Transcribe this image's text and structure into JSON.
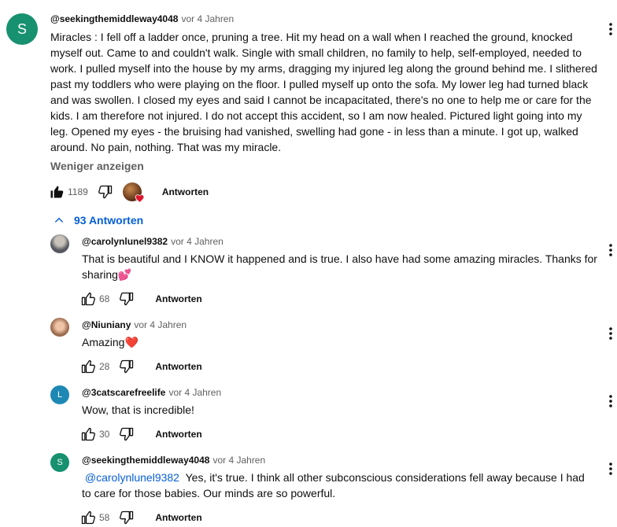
{
  "main_comment": {
    "avatar_letter": "S",
    "avatar_color": "#17916f",
    "author": "@seekingthemiddleway4048",
    "time": "vor 4 Jahren",
    "text_lines": [
      "Miracles : I fell off a ladder once, pruning a tree. Hit my head on a wall when I reached the ground, knocked",
      "myself out. Came to and couldn't walk. Single with small children, no family to help, self-employed, needed to",
      "work. I pulled myself into the house by my arms, dragging my injured leg along the ground behind me. I slithered",
      "past my toddlers who were playing on the floor. I pulled myself up onto the sofa. My lower leg had turned black",
      "and was swollen. I closed my eyes and said I cannot be incapacitated, there's no one to help me or care for the",
      "kids. I am therefore not injured. I do not accept this accident, so I am now healed. Pictured light going into my",
      "leg. Opened my eyes - the bruising had vanished, swelling had gone - in less than a minute. I got up, walked",
      "around. No pain, nothing. That was my miracle."
    ],
    "show_less": "Weniger anzeigen",
    "likes": "1189",
    "reply_label": "Antworten",
    "liked": true
  },
  "replies_toggle": "93 Antworten",
  "replies": [
    {
      "author": "@carolynlunel9382",
      "time": "vor 4 Jahren",
      "avatar_letter": "",
      "avatar_color": "#6b6e73",
      "text_lines": [
        "That is beautiful and I KNOW it happened and is true. I also have had some amazing miracles.  Thanks for",
        "sharing💕"
      ],
      "likes": "68",
      "reply_label": "Antworten"
    },
    {
      "author": "@Niuniany",
      "time": "vor 4 Jahren",
      "avatar_letter": "",
      "avatar_color": "#b98a6e",
      "text_lines": [
        "Amazing❤️"
      ],
      "likes": "28",
      "reply_label": "Antworten"
    },
    {
      "author": "@3catscarefreelife",
      "time": "vor 4 Jahren",
      "avatar_letter": "L",
      "avatar_color": "#1e88b4",
      "text_lines": [
        "Wow, that is incredible!"
      ],
      "likes": "30",
      "reply_label": "Antworten"
    },
    {
      "author": "@seekingthemiddleway4048",
      "time": "vor 4 Jahren",
      "avatar_letter": "S",
      "avatar_color": "#17916f",
      "mention": "@carolynlunel9382",
      "text_lines": [
        "Yes, it's true. I think all other subconscious considerations fell away because I had",
        "to care for those babies. Our minds are so powerful."
      ],
      "likes": "58",
      "reply_label": "Antworten"
    }
  ]
}
